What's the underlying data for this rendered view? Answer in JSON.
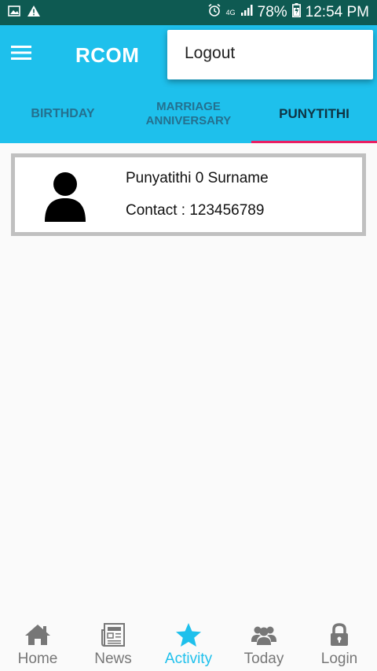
{
  "status_bar": {
    "network_type": "4G",
    "battery": "78%",
    "time": "12:54 PM",
    "icons": [
      "image-icon",
      "warning-icon",
      "alarm-icon",
      "signal-icon",
      "battery-icon"
    ]
  },
  "app_bar": {
    "title": "RCOM",
    "menu_icon": "hamburger-menu-icon",
    "color": "#1ec0ec"
  },
  "popup_menu": {
    "items": [
      {
        "label": "Logout"
      }
    ]
  },
  "tabs": [
    {
      "label": "BIRTHDAY",
      "active": false
    },
    {
      "label": "MARRIAGE ANNIVERSARY",
      "line1": "MARRIAGE",
      "line2": "ANNIVERSARY",
      "active": false
    },
    {
      "label": "PUNYTITHI",
      "active": true
    }
  ],
  "tab_indicator_color": "#e91e63",
  "records": [
    {
      "name": "Punyatithi 0 Surname",
      "contact": "Contact : 123456789",
      "avatar_icon": "person-icon"
    }
  ],
  "bottom_nav": {
    "items": [
      {
        "label": "Home",
        "icon": "home-icon",
        "active": false
      },
      {
        "label": "News",
        "icon": "newspaper-icon",
        "active": false
      },
      {
        "label": "Activity",
        "icon": "star-icon",
        "active": true
      },
      {
        "label": "Today",
        "icon": "group-icon",
        "active": false
      },
      {
        "label": "Login",
        "icon": "lock-icon",
        "active": false
      }
    ],
    "active_color": "#1ec0ec"
  }
}
